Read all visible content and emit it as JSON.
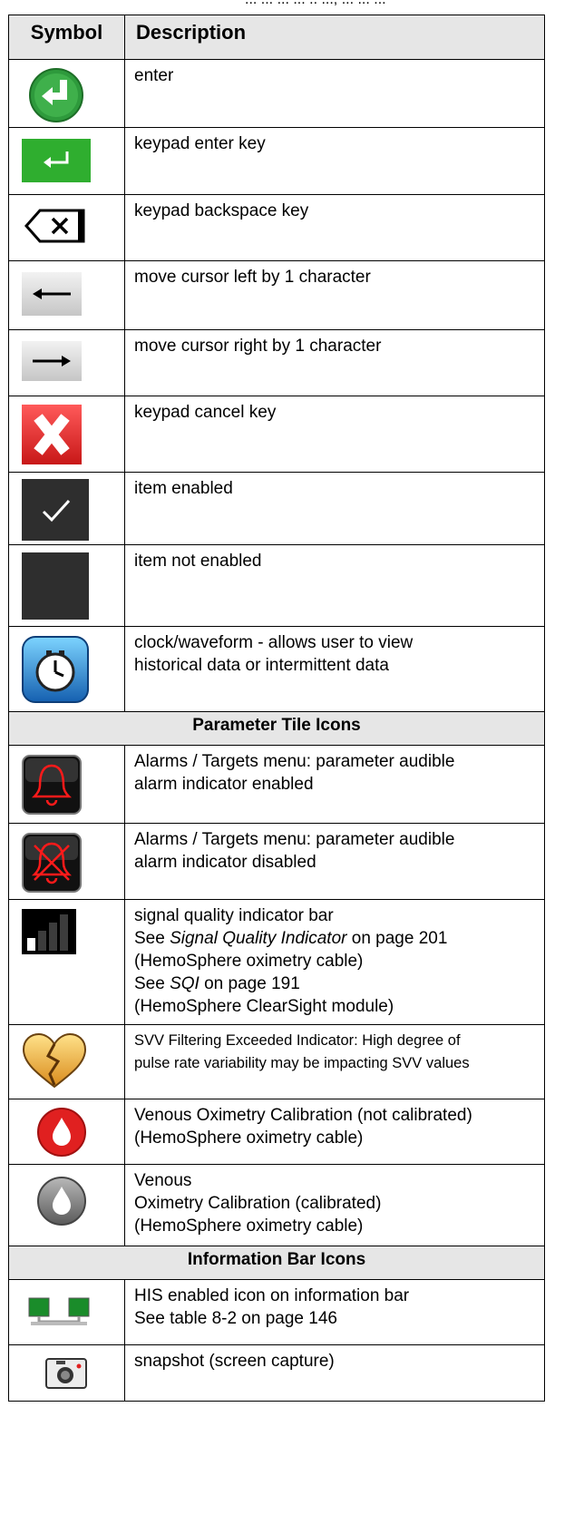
{
  "header_fragment": "... ... ... ... .. ..., ... ... ...",
  "table": {
    "col_symbol": "Symbol",
    "col_description": "Description"
  },
  "rows": {
    "enter": {
      "icon": "enter-circle-icon",
      "desc": "enter"
    },
    "keypad_enter": {
      "icon": "keypad-enter-icon",
      "desc": "keypad enter key"
    },
    "backspace": {
      "icon": "backspace-icon",
      "desc": "keypad backspace key"
    },
    "cursor_left": {
      "icon": "arrow-left-icon",
      "desc": "move cursor left by 1 character"
    },
    "cursor_right": {
      "icon": "arrow-right-icon",
      "desc": "move cursor right by 1 character"
    },
    "cancel": {
      "icon": "cancel-x-icon",
      "desc": "keypad cancel key"
    },
    "enabled": {
      "icon": "checkbox-checked-icon",
      "desc": "item enabled"
    },
    "not_enabled": {
      "icon": "checkbox-empty-icon",
      "desc": "item not enabled"
    },
    "clock": {
      "icon": "clock-waveform-icon",
      "desc_1": "clock/waveform - allows user to view",
      "desc_2": "historical data or intermittent data"
    }
  },
  "section_parameter": "Parameter Tile Icons",
  "param_rows": {
    "alarm_on": {
      "icon": "bell-icon",
      "desc_1": "Alarms / Targets menu: parameter audible",
      "desc_2": "alarm indicator enabled"
    },
    "alarm_off": {
      "icon": "bell-muted-icon",
      "desc_1": "Alarms / Targets menu: parameter audible",
      "desc_2": "alarm indicator disabled"
    },
    "sqi": {
      "icon": "signal-bars-icon",
      "line1": "signal quality indicator bar",
      "line2_pre": "See ",
      "line2_it": "Signal Quality Indicator",
      "line2_post": " on page 201",
      "line3": "(HemoSphere oximetry cable)",
      "line4_pre": "See ",
      "line4_it": "SQI",
      "line4_post": " on page 191",
      "line5": "(HemoSphere ClearSight module)"
    },
    "svv": {
      "icon": "broken-heart-icon",
      "desc_1": "SVV Filtering Exceeded Indicator: High degree of",
      "desc_2": "pulse rate variability may be impacting SVV values"
    },
    "vo_not_cal": {
      "icon": "drop-red-icon",
      "desc_1": "Venous Oximetry Calibration (not calibrated)",
      "desc_2": "(HemoSphere oximetry cable)"
    },
    "vo_cal": {
      "icon": "drop-gray-icon",
      "desc_1": "Venous",
      "desc_2": "Oximetry Calibration (calibrated)",
      "desc_3": "(HemoSphere oximetry cable)"
    }
  },
  "section_info": "Information Bar Icons",
  "info_rows": {
    "his": {
      "icon": "his-monitors-icon",
      "desc_1": "HIS enabled icon on information bar",
      "desc_2": "See table 8-2 on page 146"
    },
    "snapshot": {
      "icon": "camera-icon",
      "desc": "snapshot (screen capture)"
    }
  }
}
